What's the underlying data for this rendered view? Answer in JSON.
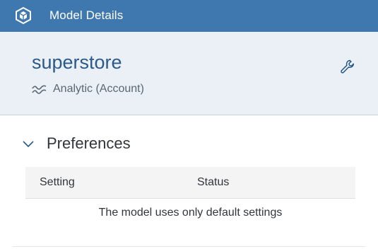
{
  "topbar": {
    "title": "Model Details",
    "icon": "cube-icon",
    "background": "#3f78ae"
  },
  "model": {
    "name": "superstore",
    "type_label": "Analytic (Account)",
    "type_icon": "wave-icon",
    "settings_icon": "wrench-icon"
  },
  "preferences": {
    "title": "Preferences",
    "expanded": true,
    "columns": [
      "Setting",
      "Status"
    ],
    "empty_message": "The model uses only default settings",
    "rows": []
  }
}
